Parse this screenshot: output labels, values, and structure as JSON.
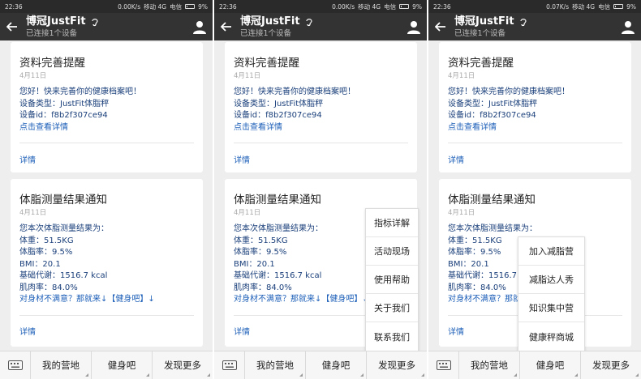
{
  "panels": [
    {
      "status": {
        "time": "22:36",
        "speed": "0.00K/s",
        "carrier": "移动 4G",
        "carrier2": "电信",
        "battery": "9%"
      }
    },
    {
      "status": {
        "time": "22:36",
        "speed": "0.00K/s",
        "carrier": "移动 4G",
        "carrier2": "电信",
        "battery": "9%"
      }
    },
    {
      "status": {
        "time": "22:36",
        "speed": "0.07K/s",
        "carrier": "移动 4G",
        "carrier2": "电信",
        "battery": "9%"
      }
    }
  ],
  "header": {
    "title": "博冠JustFit",
    "subtitle": "已连接1个设备"
  },
  "card1": {
    "title": "资料完善提醒",
    "date": "4月11日",
    "lines": [
      "您好！快来完善你的健康档案吧！",
      "设备类型：JustFit体脂秤",
      "设备id：f8b2f307ce94"
    ],
    "link": "点击查看详情",
    "detail": "详情"
  },
  "card2": {
    "title": "体脂测量结果通知",
    "date": "4月11日",
    "lines": [
      "您本次体脂测量结果为：",
      "体重：51.5KG",
      "体脂率：9.5%",
      "BMI：20.1",
      "基础代谢：1516.7 kcal",
      "肌肉率：84.0%"
    ],
    "link": "对身材不满意？那就来↓【健身吧】↓",
    "detail": "详情"
  },
  "bottom": {
    "tabs": [
      "我的营地",
      "健身吧",
      "发现更多"
    ]
  },
  "menu_more": [
    "指标详解",
    "活动现场",
    "使用帮助",
    "关于我们",
    "联系我们"
  ],
  "menu_fitness": [
    "加入减脂营",
    "减脂达人秀",
    "知识集中营",
    "健康秤商城"
  ]
}
